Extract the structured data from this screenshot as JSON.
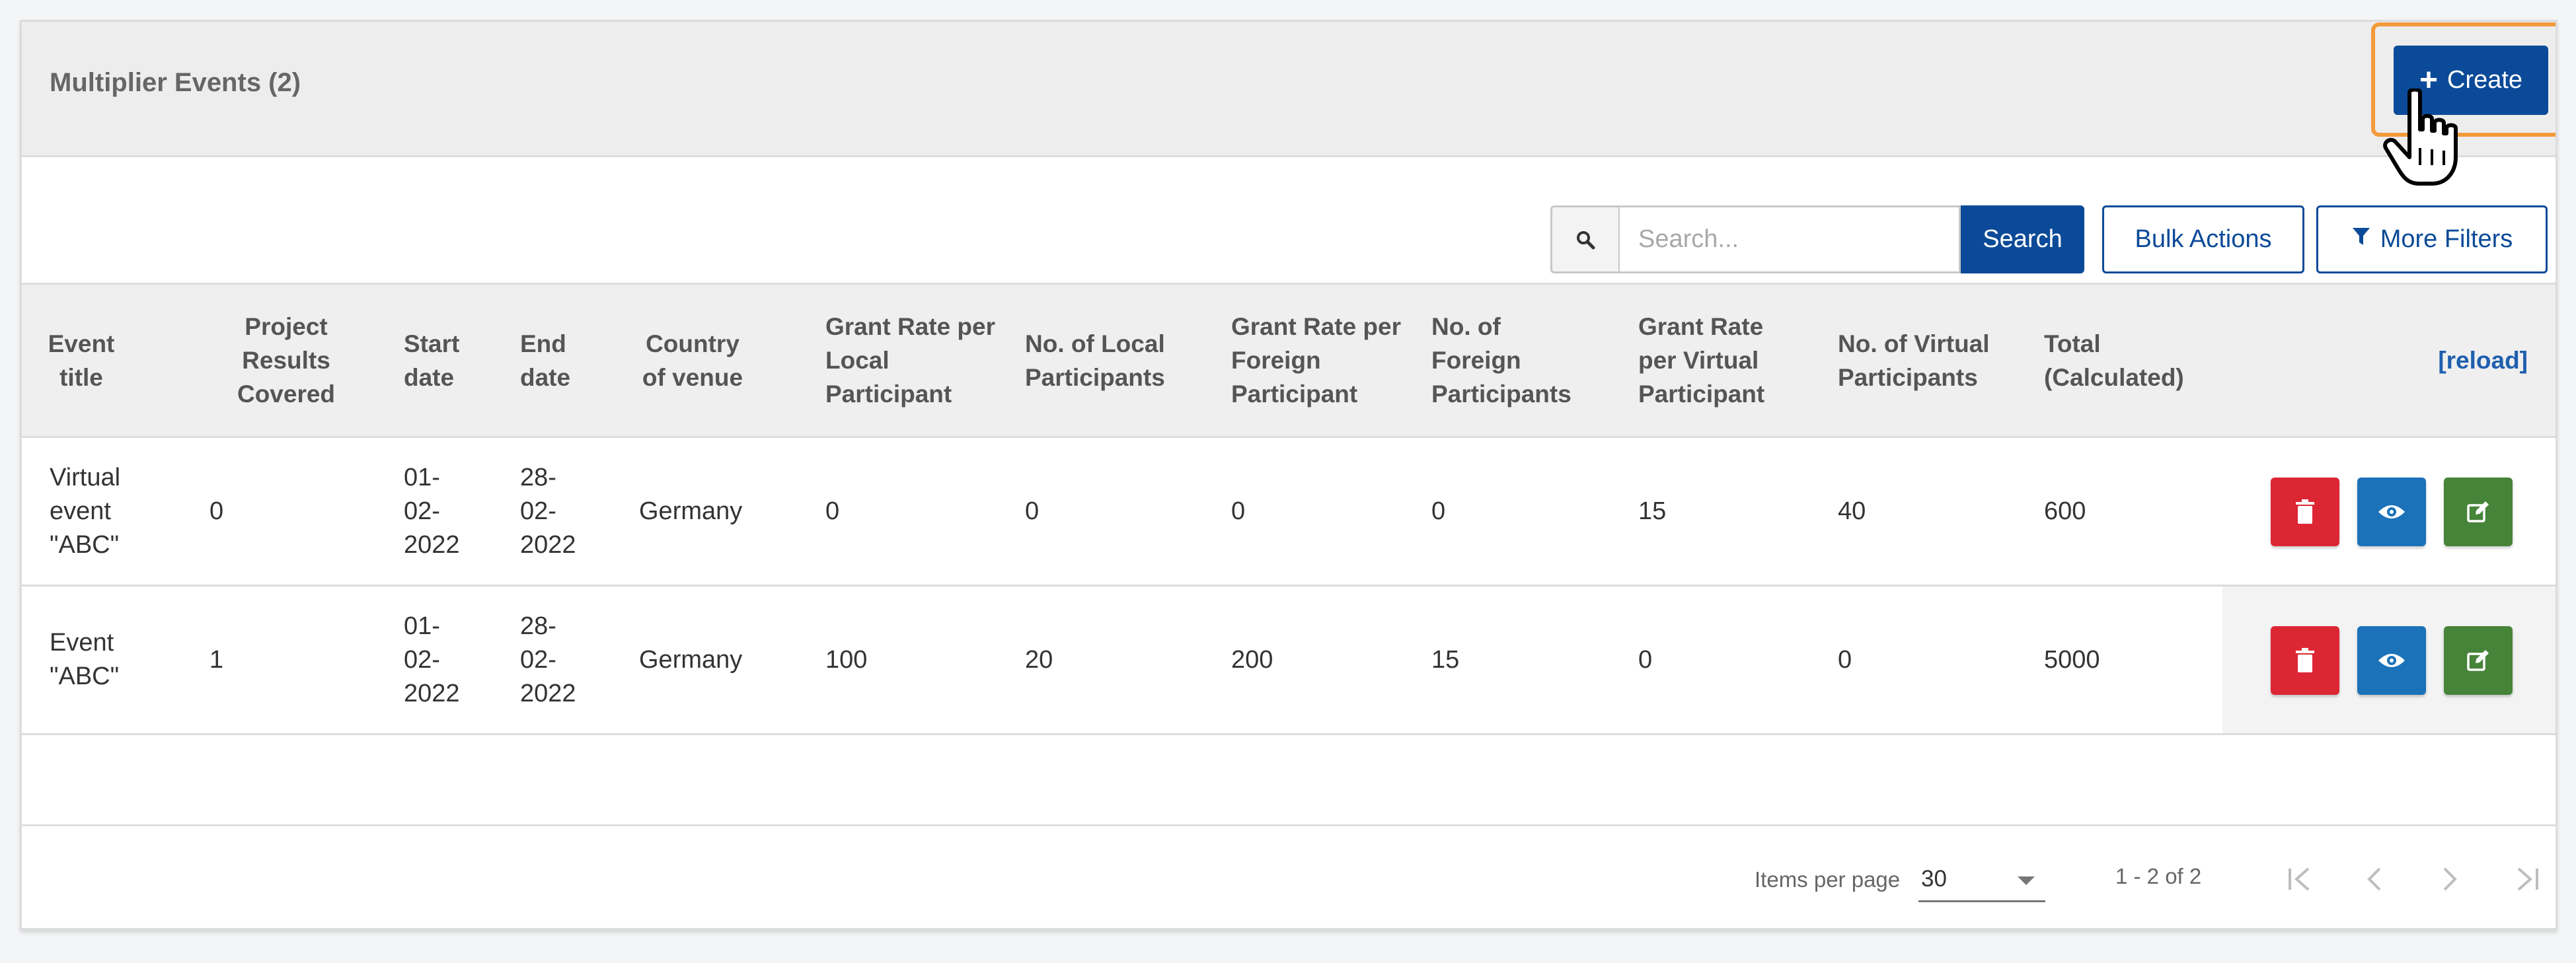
{
  "header": {
    "title": "Multiplier Events (2)",
    "create_label": "Create"
  },
  "toolbar": {
    "search_placeholder": "Search...",
    "search_label": "Search",
    "bulk_label": "Bulk Actions",
    "filters_label": "More Filters"
  },
  "table": {
    "columns": [
      "Event title",
      "Project Results Covered",
      "Start date",
      "End date",
      "Country of venue",
      "Grant Rate per Local Participant",
      "No. of Local Participants",
      "Grant Rate per Foreign Participant",
      "No. of Foreign Participants",
      "Grant Rate per Virtual Participant",
      "No. of Virtual Participants",
      "Total (Calculated)"
    ],
    "reload_label": "[reload]",
    "rows": [
      [
        "Virtual event \"ABC\"",
        "0",
        "01-02-2022",
        "28-02-2022",
        "Germany",
        "0",
        "0",
        "0",
        "0",
        "15",
        "40",
        "600"
      ],
      [
        "Event \"ABC\"",
        "1",
        "01-02-2022",
        "28-02-2022",
        "Germany",
        "100",
        "20",
        "200",
        "15",
        "0",
        "0",
        "5000"
      ]
    ]
  },
  "pagination": {
    "items_per_page_label": "Items per page",
    "items_per_page_value": "30",
    "range_label": "1 - 2 of 2"
  },
  "icons": {
    "search": "search-icon",
    "filter": "filter-icon",
    "plus": "plus-icon",
    "delete": "trash-icon",
    "view": "eye-icon",
    "edit": "edit-icon",
    "cursor": "hand-pointer-icon"
  },
  "colors": {
    "primary": "#0b4a98",
    "delete": "#dc2634",
    "view": "#1b72b9",
    "edit": "#46843a",
    "highlight": "#f39a3b"
  }
}
